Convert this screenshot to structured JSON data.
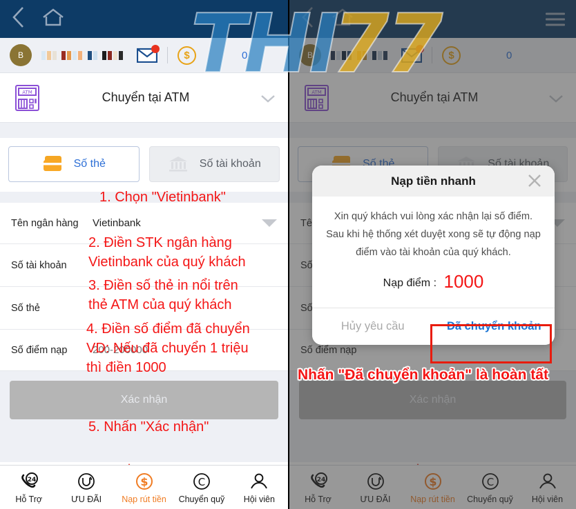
{
  "watermark": {
    "text_blue": "THI",
    "text_gold": "77",
    "color_blue": "#2a7fc1",
    "color_gold": "#dfaa1e"
  },
  "topbar": {
    "back_icon": "chevron-left-icon",
    "home_icon": "home-icon",
    "menu_icon": "hamburger-menu-icon",
    "bg_color": "#0d3b66"
  },
  "account": {
    "avatar_letter": "B",
    "mail_icon": "envelope-icon",
    "has_unread": true,
    "coin_icon": "dollar-coin-icon",
    "balance": "0",
    "balance_color": "#2d6fd6"
  },
  "atm_header": {
    "icon": "atm-machine-icon",
    "title": "Chuyển tại ATM",
    "chevron_icon": "chevron-down-icon"
  },
  "tabs": [
    {
      "label": "Số thẻ",
      "icon": "credit-card-icon",
      "active": true
    },
    {
      "label": "Số tài khoản",
      "icon": "bank-building-icon",
      "active": false
    }
  ],
  "form": {
    "rows": [
      {
        "label": "Tên ngân hàng",
        "value": "Vietinbank",
        "placeholder": "",
        "has_caret": true
      },
      {
        "label": "Số tài khoản",
        "value": "",
        "placeholder": "",
        "has_caret": false
      },
      {
        "label": "Số thẻ",
        "value": "",
        "placeholder": "",
        "has_caret": false
      },
      {
        "label": "Số điểm nạp",
        "value": "",
        "placeholder": "200-200000",
        "has_caret": false
      }
    ]
  },
  "confirm_button": {
    "label": "Xác nhận",
    "color_left": "#b5b5b5",
    "color_right": "#256b7e"
  },
  "warning": {
    "icon": "warning-triangle-icon",
    "text": "Chú ý"
  },
  "bottom_nav": [
    {
      "label": "Hỗ Trợ",
      "icon": "phone-24h-icon",
      "active": false
    },
    {
      "label": "ƯU ĐÃI",
      "icon": "promo-u-icon",
      "active": false
    },
    {
      "label": "Nạp rút tiền",
      "icon": "dollar-circle-icon",
      "active": true
    },
    {
      "label": "Chuyển quỹ",
      "icon": "transfer-c-icon",
      "active": false
    },
    {
      "label": "Hội viên",
      "icon": "user-person-icon",
      "active": false
    }
  ],
  "annotations_left": [
    {
      "id": "step-1",
      "text": "1. Chọn \"Vietinbank\""
    },
    {
      "id": "step-2",
      "text": "2. Điền STK ngân hàng\nVietinbank của quý khách"
    },
    {
      "id": "step-3",
      "text": "3. Điền số thẻ in nổi trên\nthẻ ATM của quý khách"
    },
    {
      "id": "step-4",
      "text": "4. Điền số điểm đã chuyển\nVD: Nếu đã chuyển 1 triệu\nthì điền 1000"
    },
    {
      "id": "step-5",
      "text": "5. Nhấn \"Xác nhận\""
    }
  ],
  "annotations_right": [
    {
      "id": "step-6",
      "text": "Nhấn \"Đã chuyển khoản\" là hoàn tất"
    }
  ],
  "modal": {
    "title": "Nạp tiền nhanh",
    "close_icon": "close-x-icon",
    "body_line1": "Xin quý khách vui lòng xác nhận lại số điểm.",
    "body_line2": "Sau khi hệ thống xét duyệt xong sẽ tự động nạp",
    "body_line3": "điểm vào tài khoản của quý khách.",
    "amount_label": "Nạp điểm :",
    "amount_value": "1000",
    "amount_color": "#f41616",
    "cancel_label": "Hủy yêu cầu",
    "confirm_label": "Đã chuyển khoản",
    "confirm_color": "#1a74d4",
    "highlight_color": "#e81c0e"
  }
}
